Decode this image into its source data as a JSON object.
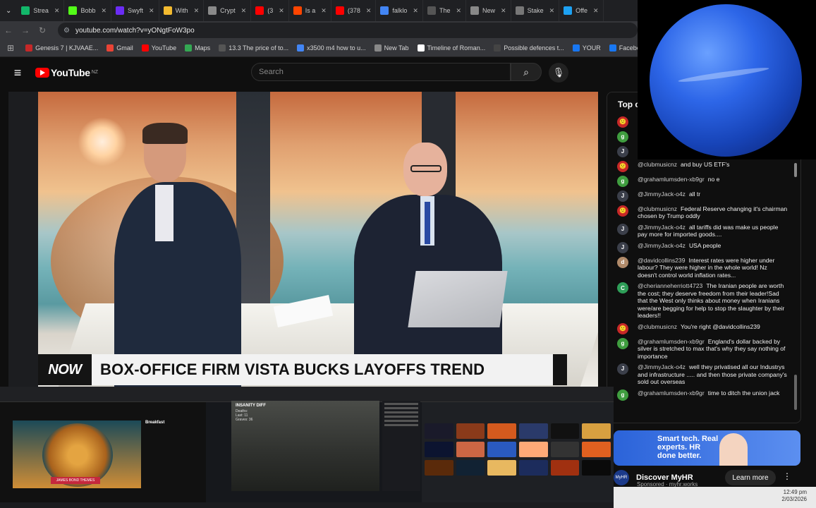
{
  "browser": {
    "tabs": [
      {
        "label": "Strea",
        "color": "#12b76a"
      },
      {
        "label": "Bobb",
        "color": "#53fc18"
      },
      {
        "label": "Swyft",
        "color": "#6b2cf5"
      },
      {
        "label": "With",
        "color": "#f3ba2f"
      },
      {
        "label": "Crypt",
        "color": "#8a8a8a"
      },
      {
        "label": "(3",
        "color": "#ff0000"
      },
      {
        "label": "Is a",
        "color": "#ff4500"
      },
      {
        "label": "(378",
        "color": "#ff0000"
      },
      {
        "label": "falklo",
        "color": "#4285f4"
      },
      {
        "label": "The",
        "color": "#555555"
      },
      {
        "label": "New",
        "color": "#888888"
      },
      {
        "label": "Stake",
        "color": "#777777"
      },
      {
        "label": "Offe",
        "color": "#1da1f2"
      }
    ],
    "url": "youtube.com/watch?v=yONgtFoW3po",
    "bookmarks": [
      {
        "label": "Genesis 7 | KJVAAE...",
        "color": "#c62828"
      },
      {
        "label": "Gmail",
        "color": "#ea4335"
      },
      {
        "label": "YouTube",
        "color": "#ff0000"
      },
      {
        "label": "Maps",
        "color": "#34a853"
      },
      {
        "label": "13.3 The price of to...",
        "color": "#555555"
      },
      {
        "label": "x3500 m4 how to u...",
        "color": "#4285f4"
      },
      {
        "label": "New Tab",
        "color": "#888888"
      },
      {
        "label": "Timeline of Roman...",
        "color": "#ffffff"
      },
      {
        "label": "Possible defences t...",
        "color": "#444444"
      },
      {
        "label": "YOUR",
        "color": "#1877f2"
      },
      {
        "label": "Facebook green",
        "color": "#1877f2"
      }
    ]
  },
  "youtube": {
    "logo_text": "YouTube",
    "country_code": "NZ",
    "search_placeholder": "Search"
  },
  "video": {
    "badge": "NOW",
    "headline": "BOX-OFFICE FIRM VISTA BUCKS LAYOFFS TREND"
  },
  "chat": {
    "header": "Top c",
    "messages": [
      {
        "avatar": "🙁",
        "avatar_color": "#c62828",
        "author": "",
        "text": ""
      },
      {
        "avatar": "g",
        "avatar_color": "#3f9d3f",
        "author": "",
        "text": ""
      },
      {
        "avatar": "J",
        "avatar_color": "#3b3f4a",
        "author": "",
        "text": ""
      },
      {
        "avatar": "🙁",
        "avatar_color": "#c62828",
        "author": "@clubmusicnz",
        "text": "and buy US ETF's"
      },
      {
        "avatar": "g",
        "avatar_color": "#3f9d3f",
        "author": "@grahamlumsden-xb9gr",
        "text": "no e"
      },
      {
        "avatar": "J",
        "avatar_color": "#3b3f4a",
        "author": "@JimmyJack-o4z",
        "text": "all tr"
      },
      {
        "avatar": "🙁",
        "avatar_color": "#c62828",
        "author": "@clubmusicnz",
        "text": "Federal Reserve changing it's chairman chosen by Trump oddly"
      },
      {
        "avatar": "J",
        "avatar_color": "#3b3f4a",
        "author": "@JimmyJack-o4z",
        "text": "all tariffs did was make us people pay more for imported goods...."
      },
      {
        "avatar": "J",
        "avatar_color": "#3b3f4a",
        "author": "@JimmyJack-o4z",
        "text": "USA people"
      },
      {
        "avatar": "d",
        "avatar_color": "#b08a6a",
        "author": "@davidcollins239",
        "text": "Interest rates were higher under labour? They were higher in the whole world! Nz doesn't control world inflation rates..."
      },
      {
        "avatar": "C",
        "avatar_color": "#2e9e58",
        "author": "@cherianneherriott4723",
        "text": "The Iranian people are worth the cost; they deserve freedom from their leader!Sad that the West only thinks about money when Iranians were/are begging for help to stop the slaughter by their leaders!!"
      },
      {
        "avatar": "🙁",
        "avatar_color": "#c62828",
        "author": "@clubmusicnz",
        "text": "You're right @davidcollins239"
      },
      {
        "avatar": "g",
        "avatar_color": "#3f9d3f",
        "author": "@grahamlumsden-xb9gr",
        "text": "England's dollar backed by silver is stretched to max that's why they say nothing of importance"
      },
      {
        "avatar": "J",
        "avatar_color": "#3b3f4a",
        "author": "@JimmyJack-o4z",
        "text": "well they privatised all our Industrys and infrastructure ..... and then those private company's sold out overseas"
      },
      {
        "avatar": "g",
        "avatar_color": "#3f9d3f",
        "author": "@grahamlumsden-xb9gr",
        "text": "time to ditch the union jack"
      }
    ]
  },
  "ad": {
    "banner_text": "Smart tech. Real experts. HR done better.",
    "logo_text": "MyHR",
    "title": "Discover MyHR",
    "sponsor": "Sponsored · myhr.works",
    "cta": "Learn more"
  },
  "thumbnails": {
    "left": {
      "label": "JAMES BOND THEMES",
      "side_title": "Breakfast"
    },
    "middle": {
      "overlay_title": "INSANITY DIFF",
      "overlay_lines": [
        "Deaths:",
        "Last: 11",
        "Graves: 36"
      ]
    }
  },
  "clock": {
    "time": "12:49 pm",
    "date": "2/03/2026"
  },
  "colors": {
    "yt_red": "#ff0000",
    "accent_blue": "#2b63d9",
    "neptune_blue": "#2d66e8"
  }
}
